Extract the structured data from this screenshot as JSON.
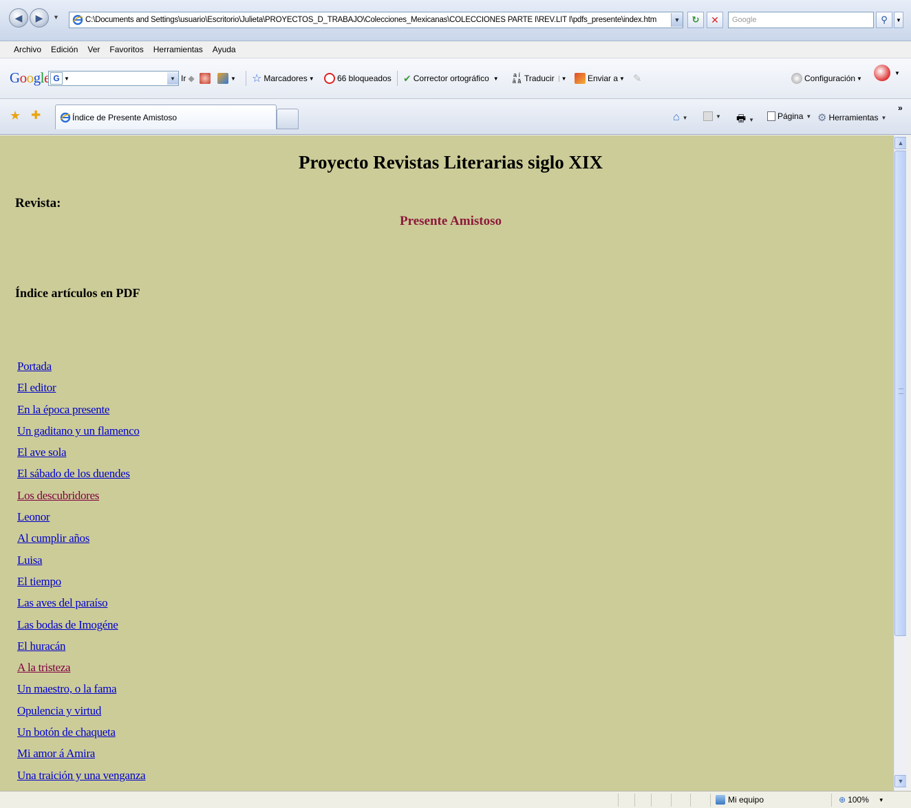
{
  "address": {
    "url": "C:\\Documents and Settings\\usuario\\Escritorio\\Julieta\\PROYECTOS_D_TRABAJO\\Colecciones_Mexicanas\\COLECCIONES PARTE I\\REV.LIT I\\pdfs_presente\\index.htm",
    "search_placeholder": "Google"
  },
  "menu": [
    "Archivo",
    "Edición",
    "Ver",
    "Favoritos",
    "Herramientas",
    "Ayuda"
  ],
  "google_toolbar": {
    "logo": "Google",
    "go_label": "Ir",
    "bookmarks_label": "Marcadores",
    "blocked_label": "66 bloqueados",
    "spellcheck_label": "Corrector ortográfico",
    "translate_label": "Traducir",
    "send_label": "Enviar a",
    "settings_label": "Configuración"
  },
  "tabs": {
    "active_title": "Índice de Presente Amistoso"
  },
  "command_bar": {
    "page_label": "Página",
    "tools_label": "Herramientas"
  },
  "page": {
    "heading": "Proyecto Revistas Literarias siglo XIX",
    "revista_label": "Revista:",
    "revista_name": "Presente Amistoso",
    "index_heading": "Índice artículos en PDF",
    "articles": [
      {
        "title": "Portada",
        "visited": false
      },
      {
        "title": "El editor",
        "visited": false
      },
      {
        "title": "En la época presente",
        "visited": false
      },
      {
        "title": "Un gaditano y un flamenco",
        "visited": false
      },
      {
        "title": "El ave sola",
        "visited": false
      },
      {
        "title": "El sábado de los duendes",
        "visited": false
      },
      {
        "title": "Los descubridores",
        "visited": true
      },
      {
        "title": "Leonor",
        "visited": false
      },
      {
        "title": "Al cumplir años",
        "visited": false
      },
      {
        "title": "Luisa",
        "visited": false
      },
      {
        "title": "El tiempo",
        "visited": false
      },
      {
        "title": "Las aves del paraíso",
        "visited": false
      },
      {
        "title": "Las bodas de Imogéne",
        "visited": false
      },
      {
        "title": "El huracán",
        "visited": false
      },
      {
        "title": "A la tristeza",
        "visited": true
      },
      {
        "title": "Un maestro, o la fama",
        "visited": false
      },
      {
        "title": "Opulencia y virtud",
        "visited": false
      },
      {
        "title": "Un botón de chaqueta",
        "visited": false
      },
      {
        "title": "Mi amor á Amira",
        "visited": false
      },
      {
        "title": "Una traición y una venganza",
        "visited": false
      }
    ]
  },
  "status_bar": {
    "zone": "Mi equipo",
    "zoom": "100%"
  },
  "colors": {
    "page_background": "#cccc99",
    "link": "#0000cc",
    "visited_link": "#800040",
    "revista_name": "#8b1a3a"
  }
}
